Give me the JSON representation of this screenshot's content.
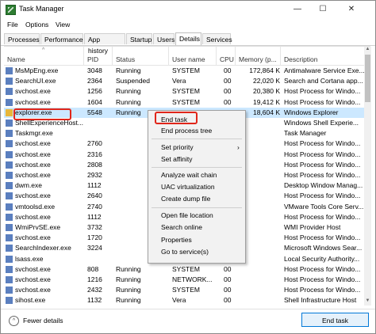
{
  "window": {
    "title": "Task Manager",
    "icon": "task-manager-icon"
  },
  "window_controls": {
    "minimize": "—",
    "maximize": "☐",
    "close": "✕"
  },
  "menu": [
    "File",
    "Options",
    "View"
  ],
  "tabs": [
    "Processes",
    "Performance",
    "App history",
    "Startup",
    "Users",
    "Details",
    "Services"
  ],
  "active_tab": "Details",
  "columns": [
    "Name",
    "PID",
    "Status",
    "User name",
    "CPU",
    "Memory (p...",
    "Description"
  ],
  "sort_glyph": "^",
  "rows": [
    {
      "name": "MsMpEng.exe",
      "pid": "3048",
      "status": "Running",
      "user": "SYSTEM",
      "cpu": "00",
      "mem": "172,864 K",
      "desc": "Antimalware Service Exe..."
    },
    {
      "name": "SearchUI.exe",
      "pid": "2364",
      "status": "Suspended",
      "user": "Vera",
      "cpu": "00",
      "mem": "22,020 K",
      "desc": "Search and Cortana app..."
    },
    {
      "name": "svchost.exe",
      "pid": "1256",
      "status": "Running",
      "user": "SYSTEM",
      "cpu": "00",
      "mem": "20,380 K",
      "desc": "Host Process for Windo..."
    },
    {
      "name": "svchost.exe",
      "pid": "1604",
      "status": "Running",
      "user": "SYSTEM",
      "cpu": "00",
      "mem": "19,412 K",
      "desc": "Host Process for Windo..."
    },
    {
      "name": "explorer.exe",
      "pid": "5548",
      "status": "Running",
      "user": "",
      "cpu": "",
      "mem": "18,604 K",
      "desc": "Windows Explorer"
    },
    {
      "name": "ShellExperienceHost...",
      "pid": "",
      "status": "",
      "user": "",
      "cpu": "",
      "mem": "",
      "desc": "Windows Shell Experie..."
    },
    {
      "name": "Taskmgr.exe",
      "pid": "",
      "status": "",
      "user": "",
      "cpu": "",
      "mem": "",
      "desc": "Task Manager"
    },
    {
      "name": "svchost.exe",
      "pid": "2760",
      "status": "",
      "user": "",
      "cpu": "",
      "mem": "",
      "desc": "Host Process for Windo..."
    },
    {
      "name": "svchost.exe",
      "pid": "2316",
      "status": "",
      "user": "",
      "cpu": "",
      "mem": "",
      "desc": "Host Process for Windo..."
    },
    {
      "name": "svchost.exe",
      "pid": "2808",
      "status": "",
      "user": "",
      "cpu": "",
      "mem": "",
      "desc": "Host Process for Windo..."
    },
    {
      "name": "svchost.exe",
      "pid": "2932",
      "status": "",
      "user": "",
      "cpu": "",
      "mem": "",
      "desc": "Host Process for Windo..."
    },
    {
      "name": "dwm.exe",
      "pid": "1112",
      "status": "",
      "user": "",
      "cpu": "",
      "mem": "",
      "desc": "Desktop Window Manag..."
    },
    {
      "name": "svchost.exe",
      "pid": "2640",
      "status": "",
      "user": "",
      "cpu": "",
      "mem": "",
      "desc": "Host Process for Windo..."
    },
    {
      "name": "vmtoolsd.exe",
      "pid": "2740",
      "status": "",
      "user": "",
      "cpu": "",
      "mem": "",
      "desc": "VMware Tools Core Serv..."
    },
    {
      "name": "svchost.exe",
      "pid": "1112",
      "status": "",
      "user": "",
      "cpu": "",
      "mem": "",
      "desc": "Host Process for Windo..."
    },
    {
      "name": "WmiPrvSE.exe",
      "pid": "3732",
      "status": "",
      "user": "",
      "cpu": "",
      "mem": "",
      "desc": "WMI Provider Host"
    },
    {
      "name": "svchost.exe",
      "pid": "1720",
      "status": "",
      "user": "",
      "cpu": "",
      "mem": "",
      "desc": "Host Process for Windo..."
    },
    {
      "name": "SearchIndexer.exe",
      "pid": "3224",
      "status": "",
      "user": "",
      "cpu": "",
      "mem": "",
      "desc": "Microsoft Windows Sear..."
    },
    {
      "name": "lsass.exe",
      "pid": "",
      "status": "",
      "user": "",
      "cpu": "",
      "mem": "",
      "desc": "Local Security Authority..."
    },
    {
      "name": "svchost.exe",
      "pid": "808",
      "status": "Running",
      "user": "SYSTEM",
      "cpu": "00",
      "mem": "",
      "desc": "Host Process for Windo..."
    },
    {
      "name": "svchost.exe",
      "pid": "1216",
      "status": "Running",
      "user": "NETWORK...",
      "cpu": "00",
      "mem": "",
      "desc": "Host Process for Windo..."
    },
    {
      "name": "svchost.exe",
      "pid": "2432",
      "status": "Running",
      "user": "SYSTEM",
      "cpu": "00",
      "mem": "",
      "desc": "Host Process for Windo..."
    },
    {
      "name": "sihost.exe",
      "pid": "1132",
      "status": "Running",
      "user": "Vera",
      "cpu": "00",
      "mem": "",
      "desc": "Shell Infrastructure Host"
    }
  ],
  "context_menu": {
    "end_task": "End task",
    "end_process_tree": "End process tree",
    "set_priority": "Set priority",
    "set_priority_arrow": "›",
    "set_affinity": "Set affinity",
    "analyze_wait_chain": "Analyze wait chain",
    "uac_virtualization": "UAC virtualization",
    "create_dump_file": "Create dump file",
    "open_file_location": "Open file location",
    "search_online": "Search online",
    "properties": "Properties",
    "go_to_services": "Go to service(s)"
  },
  "footer": {
    "fewer_details": "Fewer details",
    "fewer_glyph": "^",
    "end_task_button": "End task"
  },
  "scrollbar": {
    "up": "▲",
    "down": "▼"
  },
  "colors": {
    "selection": "#cce8ff",
    "highlight": "#e0261a",
    "accent": "#0078d7"
  }
}
